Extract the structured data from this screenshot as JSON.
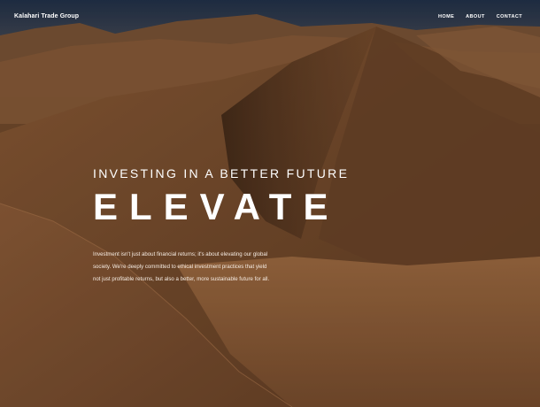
{
  "nav": {
    "brand": "Kalahari Trade Group",
    "links": [
      "HOME",
      "ABOUT",
      "CONTACT"
    ]
  },
  "hero": {
    "kicker": "INVESTING IN A BETTER FUTURE",
    "title": "ELEVATE",
    "description": "Investment isn't just about financial returns; it's about elevating our global society. We're deeply committed to ethical investment practices that yield not just profitable returns, but also a better, more sustainable future for all."
  },
  "colors": {
    "text": "#ffffff",
    "sky": "#2b3f5a",
    "sand_dark": "#5c3a22",
    "sand_light": "#9a6a42"
  }
}
